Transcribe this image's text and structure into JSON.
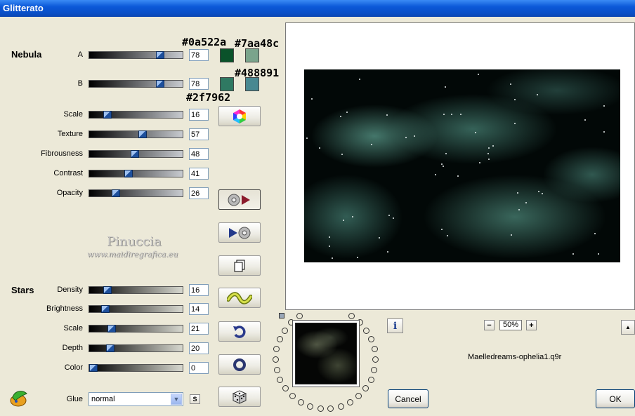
{
  "window": {
    "title": "Glitterato"
  },
  "nebula": {
    "title": "Nebula",
    "rows": [
      {
        "label": "A",
        "value": "78",
        "fraction": 0.78
      },
      {
        "label": "B",
        "value": "78",
        "fraction": 0.78
      },
      {
        "label": "Scale",
        "value": "16",
        "fraction": 0.16
      },
      {
        "label": "Texture",
        "value": "57",
        "fraction": 0.57
      },
      {
        "label": "Fibrousness",
        "value": "48",
        "fraction": 0.48
      },
      {
        "label": "Contrast",
        "value": "41",
        "fraction": 0.41
      },
      {
        "label": "Opacity",
        "value": "26",
        "fraction": 0.26
      }
    ],
    "colors": [
      {
        "hex": "#0a522a",
        "label": "#0a522a"
      },
      {
        "hex": "#7aa48c",
        "label": "#7aa48c"
      },
      {
        "hex": "#2f7962",
        "label": "#2f7962"
      },
      {
        "hex": "#488891",
        "label": "#488891"
      }
    ]
  },
  "stars": {
    "title": "Stars",
    "rows": [
      {
        "label": "Density",
        "value": "16",
        "fraction": 0.16
      },
      {
        "label": "Brightness",
        "value": "14",
        "fraction": 0.14
      },
      {
        "label": "Scale",
        "value": "21",
        "fraction": 0.21
      },
      {
        "label": "Depth",
        "value": "20",
        "fraction": 0.2
      },
      {
        "label": "Color",
        "value": "0",
        "fraction": 0.0
      }
    ]
  },
  "glue": {
    "label": "Glue",
    "value": "normal",
    "s_label": "S"
  },
  "watermark": {
    "line1": "Pinuccia",
    "line2": "www.maidiregrafica.eu"
  },
  "zoom": {
    "minus": "−",
    "value": "50%",
    "plus": "+"
  },
  "info_label": "i",
  "scroll_up": "▲",
  "preset_name": "Maelledreams-ophelia1.q9r",
  "buttons": {
    "cancel": "Cancel",
    "ok": "OK"
  }
}
